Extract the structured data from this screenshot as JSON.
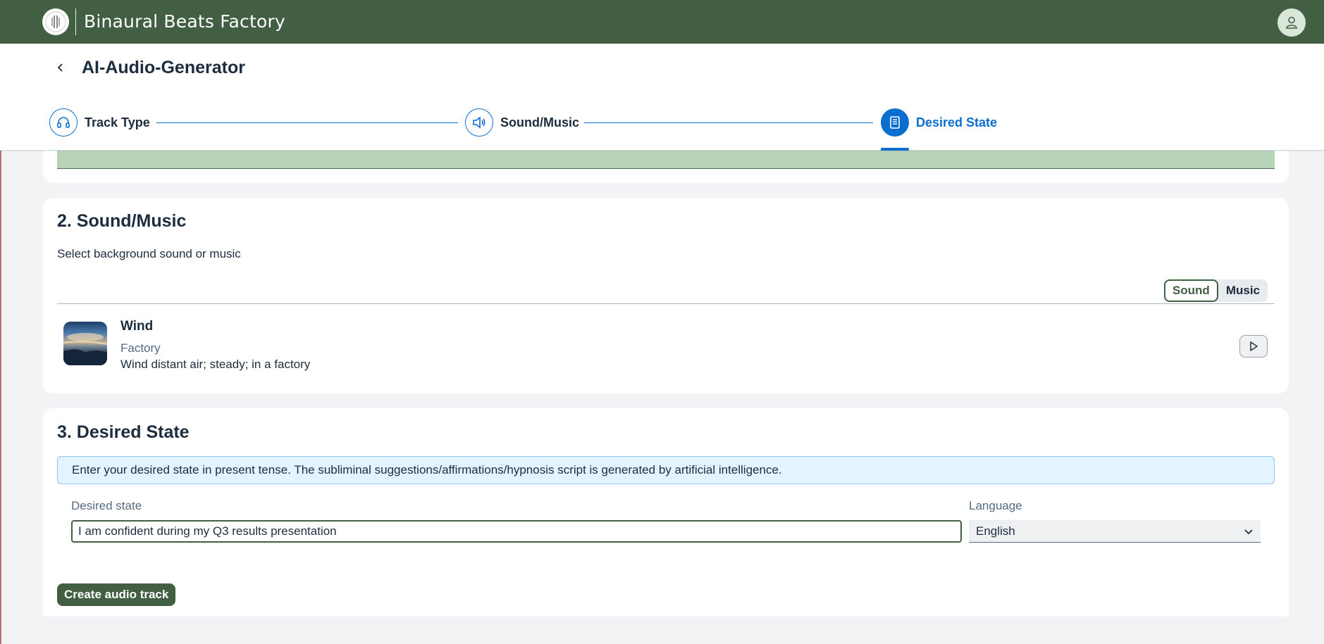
{
  "app": {
    "title": "Binaural Beats Factory"
  },
  "page": {
    "title": "AI-Audio-Generator"
  },
  "steps": [
    {
      "label": "Track Type",
      "icon": "headphones-icon"
    },
    {
      "label": "Sound/Music",
      "icon": "speaker-icon"
    },
    {
      "label": "Desired State",
      "icon": "document-icon",
      "active": true
    }
  ],
  "sound_section": {
    "title": "2. Sound/Music",
    "subtitle": "Select background sound or music",
    "toggle": {
      "sound": "Sound",
      "music": "Music",
      "selected": "Sound"
    },
    "item": {
      "title": "Wind",
      "category": "Factory",
      "description": "Wind distant air; steady; in a factory"
    }
  },
  "desired_section": {
    "title": "3. Desired State",
    "info": "Enter your desired state in present tense. The subliminal suggestions/affirmations/hypnosis script is generated by artificial intelligence.",
    "desired_label": "Desired state",
    "desired_value": "I am confident during my Q3 results presentation",
    "language_label": "Language",
    "language_value": "English",
    "create_button": "Create audio track"
  },
  "colors": {
    "shell": "#425e43",
    "accent": "#0a6ed1",
    "info_bg": "#e1f4ff",
    "green_strip": "#b8d4b8"
  }
}
